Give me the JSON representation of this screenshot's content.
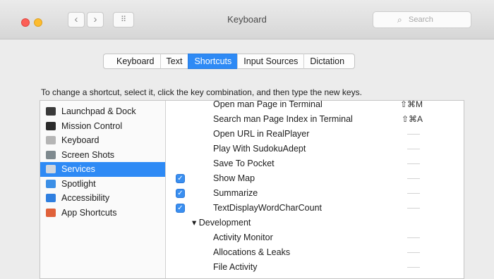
{
  "window": {
    "title": "Keyboard",
    "search_placeholder": "Search",
    "nav": {
      "back": "‹",
      "forward": "›",
      "grid": "⠿"
    }
  },
  "tabs": [
    {
      "label": "Keyboard",
      "active": false
    },
    {
      "label": "Text",
      "active": false
    },
    {
      "label": "Shortcuts",
      "active": true
    },
    {
      "label": "Input Sources",
      "active": false
    },
    {
      "label": "Dictation",
      "active": false
    }
  ],
  "instructions": "To change a shortcut, select it, click the key combination, and then type the new keys.",
  "categories": [
    {
      "label": "Launchpad & Dock",
      "icon": "launchpad-dock-icon",
      "color": "#3a3a3a"
    },
    {
      "label": "Mission Control",
      "icon": "mission-control-icon",
      "color": "#2b2b2b"
    },
    {
      "label": "Keyboard",
      "icon": "keyboard-icon",
      "color": "#b5b5b5"
    },
    {
      "label": "Screen Shots",
      "icon": "screen-shots-icon",
      "color": "#7f8a8f"
    },
    {
      "label": "Services",
      "icon": "services-gear-icon",
      "color": "#d0d6de",
      "selected": true
    },
    {
      "label": "Spotlight",
      "icon": "spotlight-icon",
      "color": "#3c8fe6"
    },
    {
      "label": "Accessibility",
      "icon": "accessibility-icon",
      "color": "#2f7fe0"
    },
    {
      "label": "App Shortcuts",
      "icon": "app-shortcuts-icon",
      "color": "#e0613a"
    }
  ],
  "shortcuts": [
    {
      "name": "Open man Page in Terminal",
      "key": "⇧⌘M",
      "checked": false
    },
    {
      "name": "Search man Page Index in Terminal",
      "key": "⇧⌘A",
      "checked": false
    },
    {
      "name": "Open URL in RealPlayer",
      "key": "",
      "checked": false
    },
    {
      "name": "Play With SudokuAdept",
      "key": "",
      "checked": false
    },
    {
      "name": "Save To Pocket",
      "key": "",
      "checked": false
    },
    {
      "name": "Show Map",
      "key": "",
      "checked": true
    },
    {
      "name": "Summarize",
      "key": "",
      "checked": true
    },
    {
      "name": "TextDisplayWordCharCount",
      "key": "",
      "checked": true
    },
    {
      "name": "▾ Development",
      "key": "",
      "checked": false,
      "group": true
    },
    {
      "name": "Activity Monitor",
      "key": "",
      "checked": false
    },
    {
      "name": "Allocations & Leaks",
      "key": "",
      "checked": false
    },
    {
      "name": "File Activity",
      "key": "",
      "checked": false
    }
  ],
  "colors": {
    "accent": "#2e8af5"
  }
}
